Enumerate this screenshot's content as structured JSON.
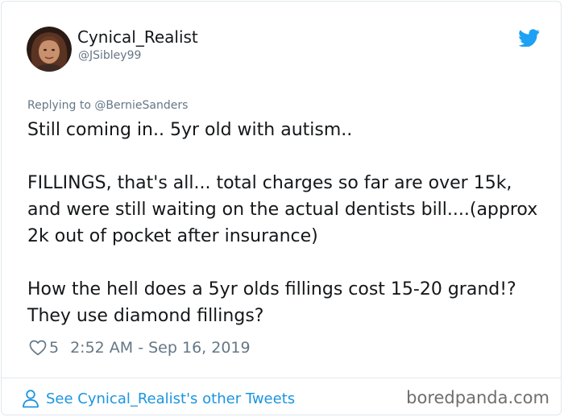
{
  "author": {
    "name": "Cynical_Realist",
    "handle": "@JSibley99",
    "avatar_icon": "avatar-photo"
  },
  "platform_icon": "twitter-bird-icon",
  "reply": {
    "prefix": "Replying to",
    "mention": "@BernieSanders"
  },
  "tweet": {
    "paragraphs": [
      "Still coming in.. 5yr old with autism..",
      "FILLINGS, that's all... total charges so far are over 15k, and were still waiting on the actual dentists bill....(approx 2k out of pocket after insurance)",
      "How the hell does a 5yr olds fillings cost 15-20 grand!? They use diamond fillings?"
    ]
  },
  "meta": {
    "like_icon": "heart-icon",
    "like_count": "5",
    "timestamp": "2:52 AM - Sep 16, 2019"
  },
  "footer": {
    "link_icon": "person-icon",
    "link_text": "See Cynical_Realist's other Tweets",
    "watermark": "boredpanda.com"
  },
  "colors": {
    "accent": "#1da1f2",
    "link": "#1b95e0",
    "text": "#14171a",
    "secondary": "#657786",
    "border": "#e1e8ed"
  }
}
